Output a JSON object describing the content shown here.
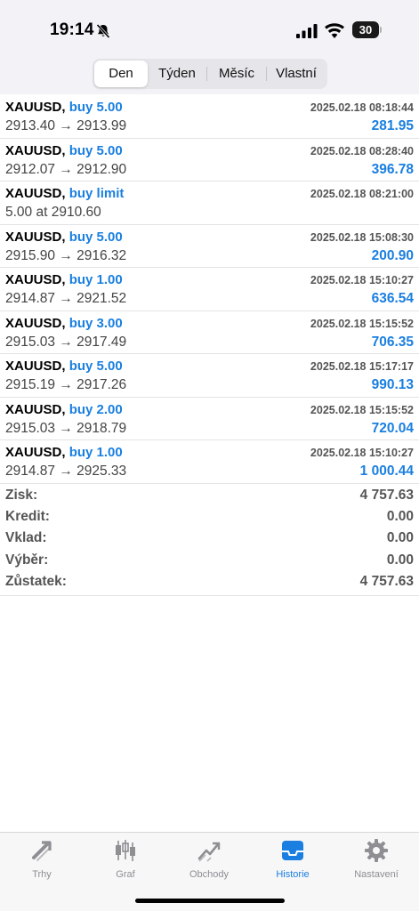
{
  "status_bar": {
    "time": "19:14",
    "battery": "30"
  },
  "segments": [
    {
      "label": "Den",
      "active": true
    },
    {
      "label": "Týden",
      "active": false
    },
    {
      "label": "Měsíc",
      "active": false
    },
    {
      "label": "Vlastní",
      "active": false
    }
  ],
  "deals": [
    {
      "symbol": "XAUUSD",
      "type": "buy 5.00",
      "time": "2025.02.18 08:18:44",
      "prices": "2913.40 → 2913.99",
      "profit": "281.95"
    },
    {
      "symbol": "XAUUSD",
      "type": "buy 5.00",
      "time": "2025.02.18 08:28:40",
      "prices": "2912.07 → 2912.90",
      "profit": "396.78"
    },
    {
      "symbol": "XAUUSD",
      "type": "buy limit",
      "time": "2025.02.18 08:21:00",
      "prices": "5.00 at 2910.60",
      "profit": ""
    },
    {
      "symbol": "XAUUSD",
      "type": "buy 5.00",
      "time": "2025.02.18 15:08:30",
      "prices": "2915.90 → 2916.32",
      "profit": "200.90"
    },
    {
      "symbol": "XAUUSD",
      "type": "buy 1.00",
      "time": "2025.02.18 15:10:27",
      "prices": "2914.87 → 2921.52",
      "profit": "636.54"
    },
    {
      "symbol": "XAUUSD",
      "type": "buy 3.00",
      "time": "2025.02.18 15:15:52",
      "prices": "2915.03 → 2917.49",
      "profit": "706.35"
    },
    {
      "symbol": "XAUUSD",
      "type": "buy 5.00",
      "time": "2025.02.18 15:17:17",
      "prices": "2915.19 → 2917.26",
      "profit": "990.13"
    },
    {
      "symbol": "XAUUSD",
      "type": "buy 2.00",
      "time": "2025.02.18 15:15:52",
      "prices": "2915.03 → 2918.79",
      "profit": "720.04"
    },
    {
      "symbol": "XAUUSD",
      "type": "buy 1.00",
      "time": "2025.02.18 15:10:27",
      "prices": "2914.87 → 2925.33",
      "profit": "1 000.44"
    }
  ],
  "summary": [
    {
      "label": "Zisk:",
      "value": "4 757.63"
    },
    {
      "label": "Kredit:",
      "value": "0.00"
    },
    {
      "label": "Vklad:",
      "value": "0.00"
    },
    {
      "label": "Výběr:",
      "value": "0.00"
    },
    {
      "label": "Zůstatek:",
      "value": "4 757.63"
    }
  ],
  "tabs": [
    {
      "label": "Trhy",
      "icon": "quotes-arrows-icon",
      "active": false
    },
    {
      "label": "Graf",
      "icon": "candlestick-icon",
      "active": false
    },
    {
      "label": "Obchody",
      "icon": "trade-chart-icon",
      "active": false
    },
    {
      "label": "Historie",
      "icon": "inbox-tray-icon",
      "active": true
    },
    {
      "label": "Nastavení",
      "icon": "gear-icon",
      "active": false
    }
  ],
  "colors": {
    "accent": "#1a7fe0",
    "muted": "#8e8e93",
    "label": "#555555"
  }
}
